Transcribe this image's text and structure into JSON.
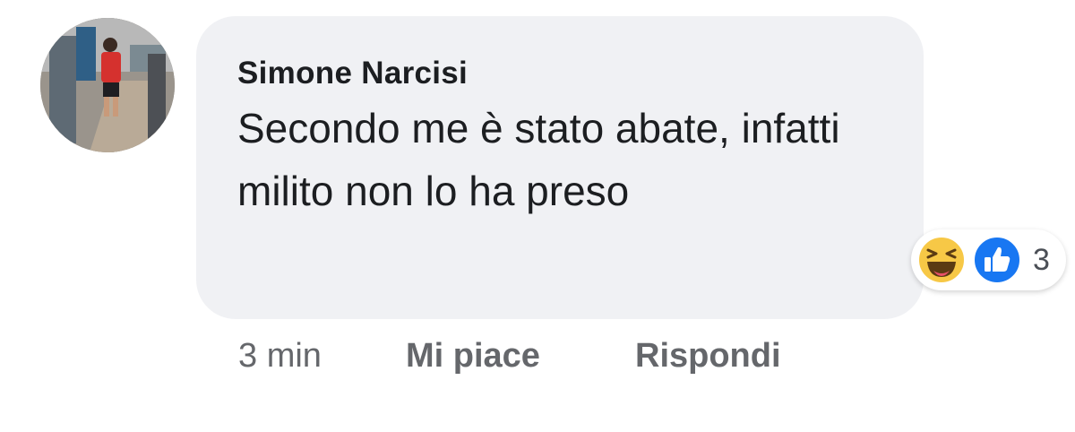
{
  "comment": {
    "author": "Simone Narcisi",
    "text": "Secondo me è stato abate, infatti milito non lo ha preso",
    "timestamp": "3 min",
    "like_label": "Mi piace",
    "reply_label": "Rispondi"
  },
  "reactions": {
    "types": [
      "haha-icon",
      "like-icon"
    ],
    "count": "3"
  },
  "colors": {
    "bubble": "#f0f1f4",
    "text": "#1c1e21",
    "meta": "#65676b",
    "like_blue": "#1877f2",
    "haha_yellow": "#f7c846"
  }
}
